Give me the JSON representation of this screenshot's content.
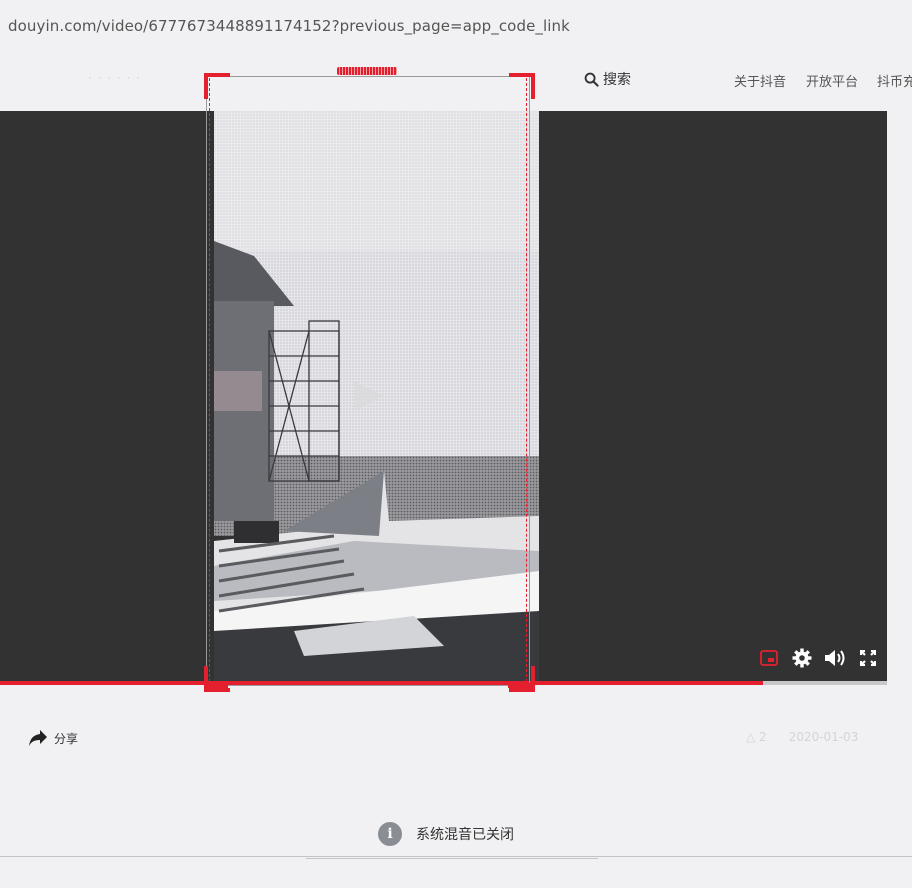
{
  "browser": {
    "url": "douyin.com/video/6777673448891174152?previous_page=app_code_link"
  },
  "header": {
    "logo_faint": "· · · · · ·",
    "search_label": "搜索",
    "nav": {
      "about": "关于抖音",
      "open_platform": "开放平台",
      "coin": "抖币充值"
    }
  },
  "player": {
    "controls": [
      "pip-icon",
      "settings-icon",
      "volume-icon",
      "fullscreen-icon"
    ],
    "progress": 0.86,
    "accent_color": "#e5202e",
    "background_color": "#323232"
  },
  "actions": {
    "share_label": "分享",
    "meta_faint_1": "△ 2",
    "meta_faint_2": "2020-01-03"
  },
  "toast": {
    "message": "系统混音已关闭",
    "icon": "info-icon"
  }
}
